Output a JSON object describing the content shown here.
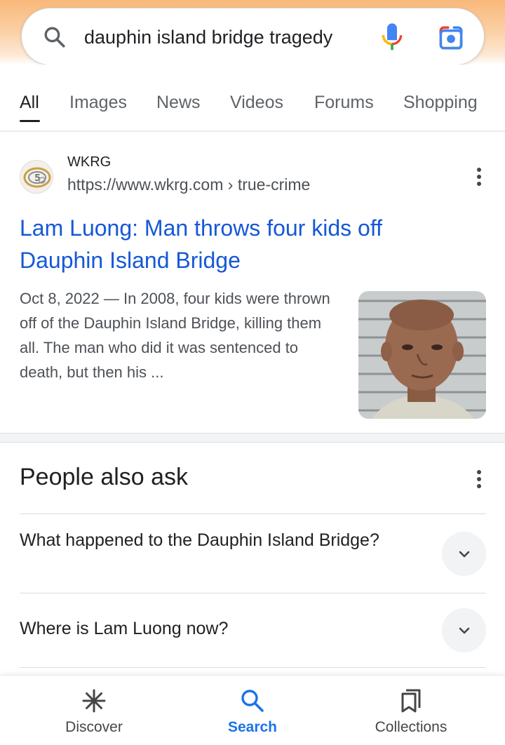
{
  "search": {
    "query": "dauphin island bridge tragedy"
  },
  "tabs": [
    {
      "label": "All",
      "active": true
    },
    {
      "label": "Images",
      "active": false
    },
    {
      "label": "News",
      "active": false
    },
    {
      "label": "Videos",
      "active": false
    },
    {
      "label": "Forums",
      "active": false
    },
    {
      "label": "Shopping",
      "active": false
    }
  ],
  "result": {
    "site_name": "WKRG",
    "url": "https://www.wkrg.com › true-crime",
    "title": "Lam Luong: Man throws four kids off Dauphin Island Bridge",
    "date": "Oct 8, 2022",
    "snippet": "Oct 8, 2022 — In 2008, four kids were thrown off of the Dauphin Island Bridge, killing them all. The man who did it was sentenced to death, but then his ..."
  },
  "people_also_ask": {
    "heading": "People also ask",
    "questions": [
      "What happened to the Dauphin Island Bridge?",
      "Where is Lam Luong now?"
    ]
  },
  "bottom_nav": [
    {
      "label": "Discover",
      "icon": "asterisk-icon",
      "active": false
    },
    {
      "label": "Search",
      "icon": "search-icon",
      "active": true
    },
    {
      "label": "Collections",
      "icon": "bookmarks-icon",
      "active": false
    }
  ],
  "colors": {
    "link": "#1558d6",
    "accent": "#1a73e8",
    "header_gradient": "#f9b87a"
  }
}
